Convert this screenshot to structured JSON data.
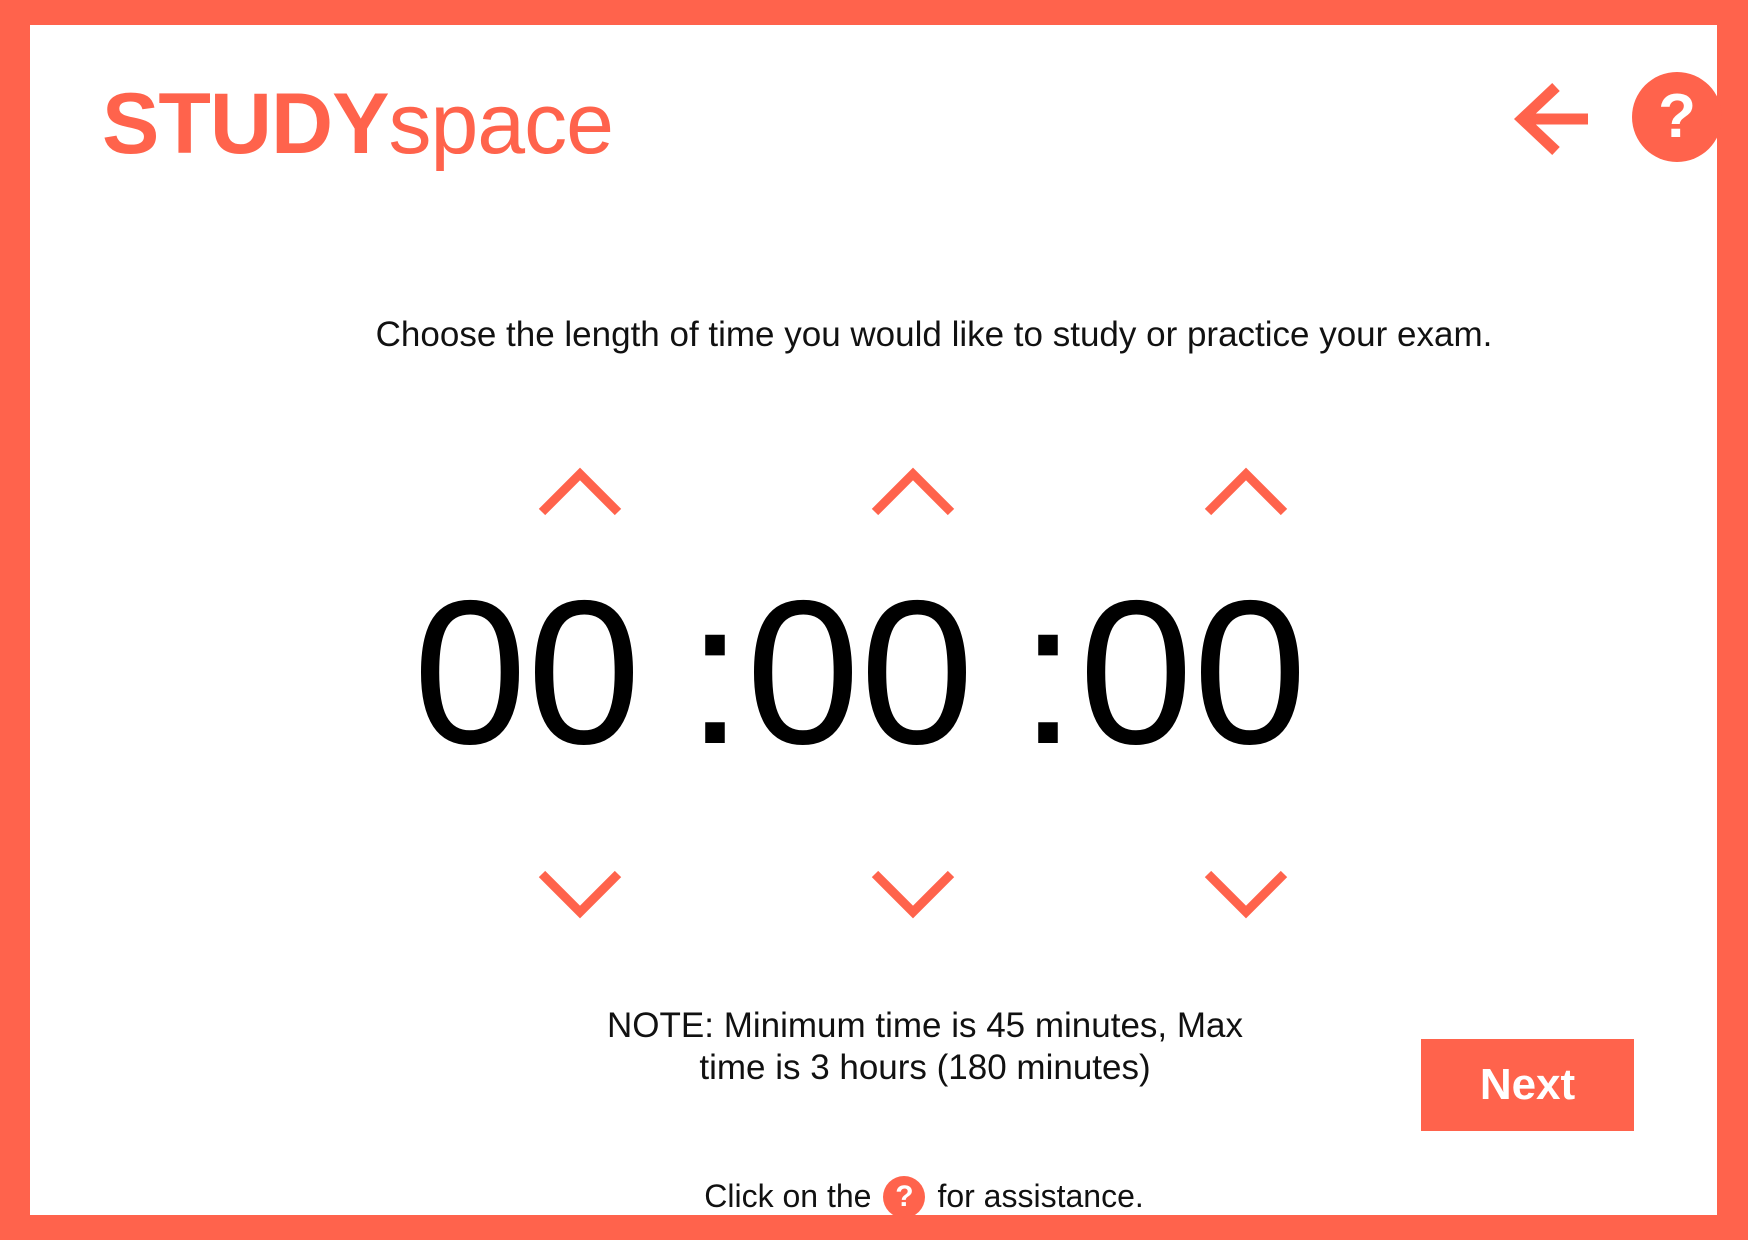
{
  "brand": {
    "bold": "STUDY",
    "light": "space"
  },
  "header": {
    "help_icon": "?"
  },
  "instruction": "Choose the length of time you would like to study or practice your exam.",
  "timer": {
    "hours": "00",
    "minutes": "00",
    "seconds": "00",
    "separator": ":"
  },
  "note": {
    "line1": "NOTE: Minimum time is 45 minutes, Max",
    "line2": "time is 3 hours (180 minutes)"
  },
  "next_label": "Next",
  "assist": {
    "before": "Click on the",
    "icon": "?",
    "after": "for assistance."
  },
  "icons": [
    "back-arrow-icon",
    "help-icon",
    "chevron-up-icon",
    "chevron-down-icon"
  ],
  "colors": {
    "accent": "#ff634c",
    "text": "#000000",
    "background": "#ffffff"
  }
}
